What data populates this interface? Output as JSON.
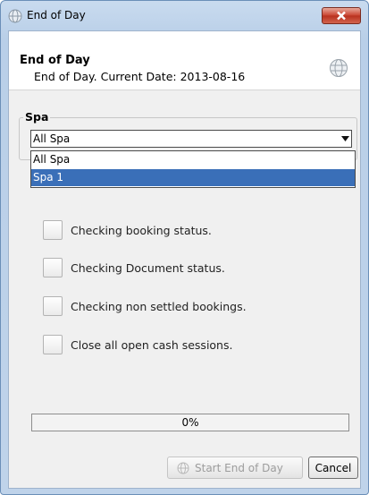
{
  "window": {
    "title": "End of Day"
  },
  "header": {
    "title": "End of Day",
    "subtitle": "End of Day. Current Date: 2013-08-16"
  },
  "spa_group": {
    "label": "Spa",
    "selected": "All Spa",
    "options": [
      "All Spa",
      "Spa 1"
    ],
    "highlighted_option": "Spa 1"
  },
  "checks": [
    {
      "label": "Checking booking status.",
      "checked": false
    },
    {
      "label": "Checking Document status.",
      "checked": false
    },
    {
      "label": "Checking non settled bookings.",
      "checked": false
    },
    {
      "label": "Close all open cash sessions.",
      "checked": false
    }
  ],
  "progress": {
    "value": 0,
    "label": "0%"
  },
  "buttons": {
    "start": "Start End of Day",
    "start_enabled": false,
    "cancel": "Cancel"
  },
  "colors": {
    "selection": "#3a6fb8",
    "close_button": "#c8422e"
  },
  "icons": {
    "app": "globe-icon",
    "close": "close-icon",
    "header": "globe-icon",
    "start": "globe-icon",
    "dropdown": "chevron-down-icon"
  }
}
